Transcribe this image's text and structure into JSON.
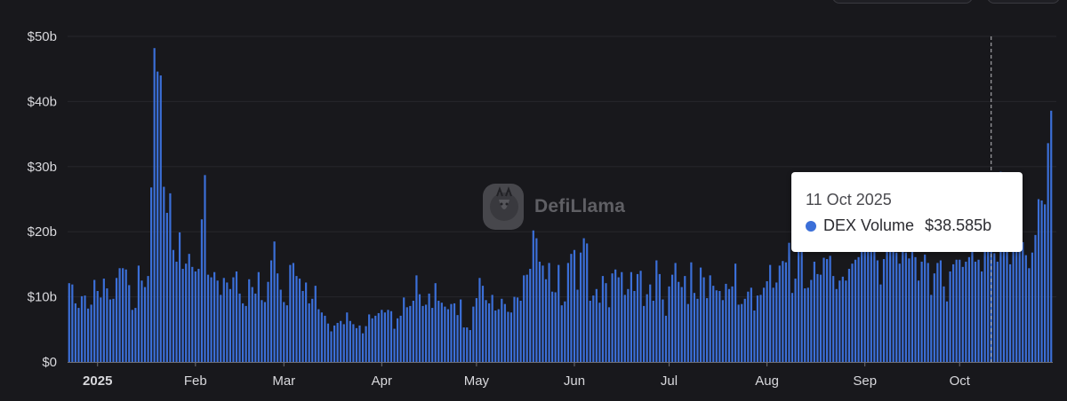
{
  "chart_data": {
    "type": "bar",
    "title": "",
    "series_name": "DEX Volume",
    "color": "#3b6fd8",
    "ylim": [
      0,
      50
    ],
    "y_ticks": [
      {
        "value": 0,
        "label": "$0"
      },
      {
        "value": 10,
        "label": "$10b"
      },
      {
        "value": 20,
        "label": "$20b"
      },
      {
        "value": 30,
        "label": "$30b"
      },
      {
        "value": 40,
        "label": "$40b"
      },
      {
        "value": 50,
        "label": "$50b"
      }
    ],
    "x_start": "2024-12-23",
    "x_ticks": [
      {
        "date": "2025-01-01",
        "label": "2025",
        "bold": true
      },
      {
        "date": "2025-02-01",
        "label": "Feb"
      },
      {
        "date": "2025-03-01",
        "label": "Mar"
      },
      {
        "date": "2025-04-01",
        "label": "Apr"
      },
      {
        "date": "2025-05-01",
        "label": "May"
      },
      {
        "date": "2025-06-01",
        "label": "Jun"
      },
      {
        "date": "2025-07-01",
        "label": "Jul"
      },
      {
        "date": "2025-08-01",
        "label": "Aug"
      },
      {
        "date": "2025-09-01",
        "label": "Sep"
      },
      {
        "date": "2025-10-01",
        "label": "Oct"
      }
    ],
    "values": [
      12.1,
      11.9,
      9.0,
      8.3,
      10.1,
      10.2,
      8.2,
      8.8,
      12.6,
      10.9,
      9.9,
      12.8,
      11.3,
      9.6,
      9.7,
      12.9,
      14.4,
      14.4,
      14.2,
      11.8,
      8.0,
      8.3,
      14.8,
      12.5,
      11.5,
      13.2,
      26.8,
      48.2,
      44.6,
      44.0,
      26.9,
      22.9,
      25.9,
      17.2,
      15.4,
      19.9,
      14.3,
      15.1,
      16.6,
      14.6,
      13.9,
      14.3,
      21.9,
      28.7,
      13.4,
      13.0,
      13.8,
      12.5,
      10.3,
      12.9,
      12.2,
      11.2,
      13.0,
      13.9,
      10.5,
      9.0,
      8.6,
      12.7,
      11.5,
      10.5,
      13.8,
      9.5,
      9.2,
      12.3,
      15.6,
      18.5,
      13.6,
      11.1,
      9.2,
      8.7,
      14.9,
      15.2,
      13.2,
      12.8,
      10.9,
      12.2,
      9.0,
      9.7,
      11.7,
      8.1,
      7.6,
      7.1,
      5.9,
      4.7,
      5.6,
      6.0,
      6.3,
      5.8,
      7.6,
      6.3,
      5.8,
      5.2,
      5.6,
      4.4,
      5.5,
      7.3,
      6.7,
      7.1,
      7.5,
      8.0,
      7.6,
      8.0,
      7.8,
      5.1,
      6.7,
      7.1,
      9.9,
      8.4,
      8.6,
      9.4,
      13.3,
      10.4,
      8.6,
      8.8,
      10.5,
      8.3,
      12.1,
      9.4,
      9.1,
      8.5,
      8.1,
      8.9,
      9.0,
      7.2,
      9.6,
      5.3,
      5.3,
      4.9,
      8.5,
      9.8,
      12.9,
      11.7,
      9.5,
      9.0,
      10.3,
      7.9,
      8.1,
      9.7,
      8.9,
      7.7,
      7.6,
      10.0,
      9.9,
      9.4,
      13.3,
      13.4,
      14.3,
      20.2,
      19.0,
      15.4,
      14.8,
      12.7,
      15.2,
      10.8,
      10.7,
      14.9,
      8.7,
      9.3,
      15.2,
      16.6,
      17.2,
      11.1,
      16.8,
      19.0,
      18.2,
      9.4,
      10.2,
      11.2,
      9.1,
      13.2,
      12.1,
      8.4,
      13.6,
      14.2,
      13.0,
      13.8,
      10.3,
      11.2,
      13.8,
      10.9,
      13.5,
      14.0,
      8.6,
      10.4,
      11.9,
      9.4,
      15.6,
      13.5,
      9.6,
      7.1,
      11.6,
      13.4,
      15.2,
      12.3,
      11.5,
      13.2,
      8.9,
      15.3,
      10.6,
      9.7,
      14.5,
      13.0,
      9.8,
      13.3,
      11.7,
      11.0,
      10.9,
      9.5,
      12.0,
      11.2,
      11.6,
      15.1,
      8.8,
      8.9,
      9.7,
      10.8,
      11.4,
      7.9,
      10.2,
      10.3,
      11.4,
      12.4,
      14.9,
      11.4,
      12.2,
      14.8,
      15.5,
      15.3,
      18.3,
      10.6,
      12.8,
      17.2,
      18.8,
      11.3,
      11.4,
      12.6,
      15.4,
      13.5,
      13.4,
      16.0,
      15.8,
      16.3,
      13.2,
      11.2,
      12.5,
      13.1,
      12.5,
      14.3,
      15.1,
      15.7,
      16.1,
      17.3,
      19.1,
      18.2,
      18.3,
      18.4,
      15.6,
      11.9,
      15.8,
      17.6,
      17.2,
      16.9,
      16.8,
      15.1,
      17.7,
      16.8,
      15.9,
      17.3,
      16.1,
      12.5,
      15.4,
      16.5,
      15.2,
      10.3,
      13.6,
      15.2,
      15.6,
      11.6,
      9.3,
      13.9,
      15.0,
      15.7,
      15.7,
      14.6,
      15.4,
      16.1,
      17.6,
      15.4,
      15.7,
      13.9,
      17.3,
      18.0,
      19.4,
      16.7,
      15.4,
      29.2,
      19.8,
      18.8,
      15.0,
      19.1,
      19.7,
      18.9,
      18.4,
      16.4,
      14.4,
      16.8,
      19.5,
      25.0,
      24.8,
      24.2,
      33.6,
      38.585
    ],
    "highlight": {
      "date": "2025-10-11",
      "label": "11 Oct 2025",
      "value": 38.585,
      "value_label": "$38.585b"
    }
  },
  "brand": {
    "name": "DefiLlama",
    "logo_icon": "llama-logo-icon"
  },
  "tooltip": {
    "date": "11 Oct 2025",
    "series": "DEX Volume",
    "value": "$38.585b",
    "dot_color": "#3b6fd8"
  }
}
